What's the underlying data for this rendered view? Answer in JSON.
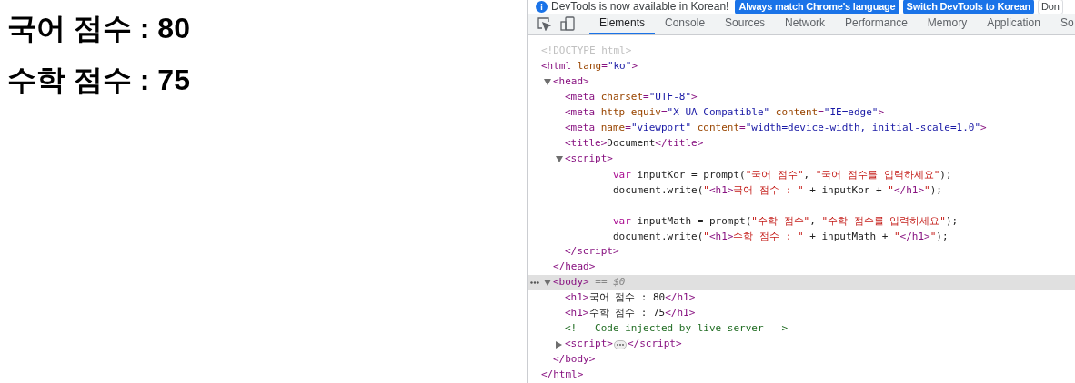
{
  "page": {
    "headings": [
      "국어 점수 : 80",
      "수학 점수 : 75"
    ]
  },
  "devtools": {
    "infobar": {
      "message": "DevTools is now available in Korean!",
      "buttons": [
        {
          "label": "Always match Chrome's language",
          "kind": "primary"
        },
        {
          "label": "Switch DevTools to Korean",
          "kind": "primary"
        },
        {
          "label": "Don",
          "kind": "secondary"
        }
      ]
    },
    "tabs": [
      {
        "label": "Elements",
        "selected": true
      },
      {
        "label": "Console",
        "selected": false
      },
      {
        "label": "Sources",
        "selected": false
      },
      {
        "label": "Network",
        "selected": false
      },
      {
        "label": "Performance",
        "selected": false
      },
      {
        "label": "Memory",
        "selected": false
      },
      {
        "label": "Application",
        "selected": false
      },
      {
        "label": "So",
        "selected": false
      }
    ],
    "tree": [
      {
        "kind": "element",
        "selected": false,
        "tokens": [
          {
            "kind": "doctype",
            "text": "<!DOCTYPE html>"
          }
        ]
      },
      {
        "kind": "element",
        "selected": false,
        "tokens": [
          {
            "kind": "tag",
            "text": "<html"
          },
          {
            "kind": "attr",
            "text": " lang"
          },
          {
            "kind": "tag",
            "text": "="
          },
          {
            "kind": "value",
            "text": "\"ko\""
          },
          {
            "kind": "tag",
            "text": ">"
          }
        ],
        "close": [
          {
            "kind": "tag",
            "text": "</html>"
          }
        ],
        "children": [
          {
            "kind": "element",
            "selected": false,
            "expanded": true,
            "tokens": [
              {
                "kind": "tag",
                "text": "<head>"
              }
            ],
            "close": [
              {
                "kind": "tag",
                "text": "</head>"
              }
            ],
            "children": [
              {
                "kind": "element",
                "selected": false,
                "tokens": [
                  {
                    "kind": "tag",
                    "text": "<meta"
                  },
                  {
                    "kind": "attr",
                    "text": " charset"
                  },
                  {
                    "kind": "tag",
                    "text": "="
                  },
                  {
                    "kind": "value",
                    "text": "\"UTF-8\""
                  },
                  {
                    "kind": "tag",
                    "text": ">"
                  }
                ]
              },
              {
                "kind": "element",
                "selected": false,
                "tokens": [
                  {
                    "kind": "tag",
                    "text": "<meta"
                  },
                  {
                    "kind": "attr",
                    "text": " http-equiv"
                  },
                  {
                    "kind": "tag",
                    "text": "="
                  },
                  {
                    "kind": "value",
                    "text": "\"X-UA-Compatible\""
                  },
                  {
                    "kind": "attr",
                    "text": " content"
                  },
                  {
                    "kind": "tag",
                    "text": "="
                  },
                  {
                    "kind": "value",
                    "text": "\"IE=edge\""
                  },
                  {
                    "kind": "tag",
                    "text": ">"
                  }
                ]
              },
              {
                "kind": "element",
                "selected": false,
                "tokens": [
                  {
                    "kind": "tag",
                    "text": "<meta"
                  },
                  {
                    "kind": "attr",
                    "text": " name"
                  },
                  {
                    "kind": "tag",
                    "text": "="
                  },
                  {
                    "kind": "value",
                    "text": "\"viewport\""
                  },
                  {
                    "kind": "attr",
                    "text": " content"
                  },
                  {
                    "kind": "tag",
                    "text": "="
                  },
                  {
                    "kind": "value",
                    "text": "\"width=device-width, initial-scale=1.0\""
                  },
                  {
                    "kind": "tag",
                    "text": ">"
                  }
                ]
              },
              {
                "kind": "element",
                "selected": false,
                "tokens": [
                  {
                    "kind": "tag",
                    "text": "<title>"
                  },
                  {
                    "kind": "text",
                    "text": "Document"
                  },
                  {
                    "kind": "tag",
                    "text": "</title>"
                  }
                ]
              },
              {
                "kind": "element",
                "selected": false,
                "expanded": true,
                "tokens": [
                  {
                    "kind": "tag",
                    "text": "<script>"
                  }
                ],
                "close": [
                  {
                    "kind": "tag",
                    "text": "</script>"
                  }
                ],
                "children": [
                  {
                    "kind": "code",
                    "selected": false,
                    "lines": [
                      {
                        "space_before": false,
                        "tokens": [
                          {
                            "kind": "keyword",
                            "text": "var"
                          },
                          {
                            "kind": "text",
                            "text": " inputKor = prompt("
                          },
                          {
                            "kind": "string",
                            "text": "\"국어 점수\""
                          },
                          {
                            "kind": "text",
                            "text": ", "
                          },
                          {
                            "kind": "string",
                            "text": "\"국어 점수를 입력하세요\""
                          },
                          {
                            "kind": "text",
                            "text": ");"
                          }
                        ]
                      },
                      {
                        "space_before": false,
                        "tokens": [
                          {
                            "kind": "text",
                            "text": "document.write("
                          },
                          {
                            "kind": "string",
                            "text": "\""
                          },
                          {
                            "kind": "tag",
                            "text": "<h1>"
                          },
                          {
                            "kind": "string",
                            "text": "국어 점수 : \""
                          },
                          {
                            "kind": "text",
                            "text": " + inputKor + "
                          },
                          {
                            "kind": "string",
                            "text": "\""
                          },
                          {
                            "kind": "tag",
                            "text": "</h1>"
                          },
                          {
                            "kind": "string",
                            "text": "\""
                          },
                          {
                            "kind": "text",
                            "text": ");"
                          }
                        ]
                      },
                      {
                        "space_before": true,
                        "tokens": [
                          {
                            "kind": "keyword",
                            "text": "var"
                          },
                          {
                            "kind": "text",
                            "text": " inputMath = prompt("
                          },
                          {
                            "kind": "string",
                            "text": "\"수학 점수\""
                          },
                          {
                            "kind": "text",
                            "text": ", "
                          },
                          {
                            "kind": "string",
                            "text": "\"수학 점수를 입력하세요\""
                          },
                          {
                            "kind": "text",
                            "text": ");"
                          }
                        ]
                      },
                      {
                        "space_before": false,
                        "tokens": [
                          {
                            "kind": "text",
                            "text": "document.write("
                          },
                          {
                            "kind": "string",
                            "text": "\""
                          },
                          {
                            "kind": "tag",
                            "text": "<h1>"
                          },
                          {
                            "kind": "string",
                            "text": "수학 점수 : \""
                          },
                          {
                            "kind": "text",
                            "text": " + inputMath + "
                          },
                          {
                            "kind": "string",
                            "text": "\""
                          },
                          {
                            "kind": "tag",
                            "text": "</h1>"
                          },
                          {
                            "kind": "string",
                            "text": "\""
                          },
                          {
                            "kind": "text",
                            "text": ");"
                          }
                        ]
                      }
                    ]
                  }
                ]
              }
            ]
          },
          {
            "kind": "element",
            "selected": true,
            "expanded": true,
            "tokens": [
              {
                "kind": "tag",
                "text": "<body>"
              },
              {
                "kind": "hint",
                "text": " == $0"
              }
            ],
            "close": [
              {
                "kind": "tag",
                "text": "</body>"
              }
            ],
            "children": [
              {
                "kind": "element",
                "selected": false,
                "tokens": [
                  {
                    "kind": "tag",
                    "text": "<h1>"
                  },
                  {
                    "kind": "text",
                    "text": "국어 점수 : 80"
                  },
                  {
                    "kind": "tag",
                    "text": "</h1>"
                  }
                ]
              },
              {
                "kind": "element",
                "selected": false,
                "tokens": [
                  {
                    "kind": "tag",
                    "text": "<h1>"
                  },
                  {
                    "kind": "text",
                    "text": "수학 점수 : 75"
                  },
                  {
                    "kind": "tag",
                    "text": "</h1>"
                  }
                ]
              },
              {
                "kind": "element",
                "selected": false,
                "tokens": [
                  {
                    "kind": "comment",
                    "text": "<!-- Code injected by live-server -->"
                  }
                ]
              },
              {
                "kind": "element",
                "selected": false,
                "expanded": false,
                "tokens": [
                  {
                    "kind": "tag",
                    "text": "<script>"
                  }
                ],
                "close": [
                  {
                    "kind": "tag",
                    "text": "</script>"
                  }
                ]
              }
            ]
          }
        ]
      }
    ]
  }
}
